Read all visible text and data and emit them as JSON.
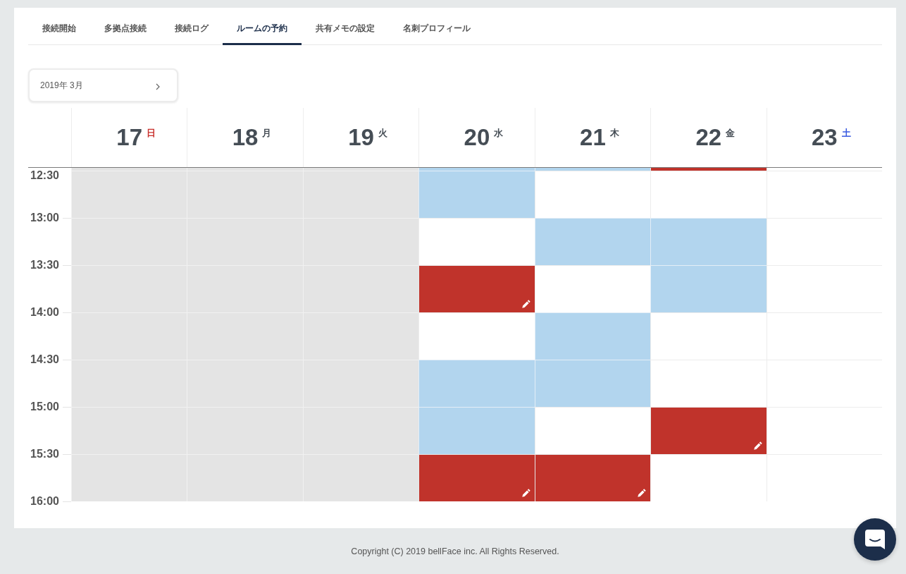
{
  "tabs": [
    {
      "label": "接続開始",
      "selected": false
    },
    {
      "label": "多拠点接続",
      "selected": false
    },
    {
      "label": "接続ログ",
      "selected": false
    },
    {
      "label": "ルームの予約",
      "selected": true
    },
    {
      "label": "共有メモの設定",
      "selected": false
    },
    {
      "label": "名刺プロフィール",
      "selected": false
    }
  ],
  "month_selector": {
    "label": "2019年 3月"
  },
  "calendar": {
    "time_labels": [
      "12:30",
      "13:00",
      "13:30",
      "14:00",
      "14:30",
      "15:00",
      "15:30",
      "16:00"
    ],
    "days": [
      {
        "date": "17",
        "weekday": "日",
        "color": "#c9302c",
        "slots": [
          {
            "kind": "past"
          },
          {
            "kind": "past"
          },
          {
            "kind": "past"
          },
          {
            "kind": "past"
          },
          {
            "kind": "past"
          },
          {
            "kind": "past"
          },
          {
            "kind": "past"
          },
          {
            "kind": "past"
          }
        ]
      },
      {
        "date": "18",
        "weekday": "月",
        "color": "#454d55",
        "slots": [
          {
            "kind": "past"
          },
          {
            "kind": "past"
          },
          {
            "kind": "past"
          },
          {
            "kind": "past"
          },
          {
            "kind": "past"
          },
          {
            "kind": "past"
          },
          {
            "kind": "past"
          },
          {
            "kind": "past"
          }
        ]
      },
      {
        "date": "19",
        "weekday": "火",
        "color": "#454d55",
        "slots": [
          {
            "kind": "past"
          },
          {
            "kind": "past"
          },
          {
            "kind": "past"
          },
          {
            "kind": "past"
          },
          {
            "kind": "past"
          },
          {
            "kind": "past"
          },
          {
            "kind": "past"
          },
          {
            "kind": "past"
          }
        ]
      },
      {
        "date": "20",
        "weekday": "水",
        "color": "#454d55",
        "slots": [
          {
            "kind": "reserved"
          },
          {
            "kind": "reserved"
          },
          {
            "kind": "free"
          },
          {
            "kind": "own"
          },
          {
            "kind": "free"
          },
          {
            "kind": "reserved"
          },
          {
            "kind": "reserved"
          },
          {
            "kind": "own"
          }
        ]
      },
      {
        "date": "21",
        "weekday": "木",
        "color": "#454d55",
        "slots": [
          {
            "kind": "reserved"
          },
          {
            "kind": "free"
          },
          {
            "kind": "reserved"
          },
          {
            "kind": "free"
          },
          {
            "kind": "reserved"
          },
          {
            "kind": "reserved"
          },
          {
            "kind": "free"
          },
          {
            "kind": "own"
          }
        ]
      },
      {
        "date": "22",
        "weekday": "金",
        "color": "#454d55",
        "slots": [
          {
            "kind": "own"
          },
          {
            "kind": "free"
          },
          {
            "kind": "reserved"
          },
          {
            "kind": "reserved"
          },
          {
            "kind": "free"
          },
          {
            "kind": "free"
          },
          {
            "kind": "own"
          },
          {
            "kind": "free"
          }
        ]
      },
      {
        "date": "23",
        "weekday": "土",
        "color": "#3a5be0",
        "slots": [
          {
            "kind": "free"
          },
          {
            "kind": "free"
          },
          {
            "kind": "free"
          },
          {
            "kind": "free"
          },
          {
            "kind": "free"
          },
          {
            "kind": "free"
          },
          {
            "kind": "free"
          },
          {
            "kind": "free"
          }
        ]
      }
    ]
  },
  "footer": {
    "copyright": "Copyright (C) 2019 bellFace inc. All Rights Reserved."
  }
}
